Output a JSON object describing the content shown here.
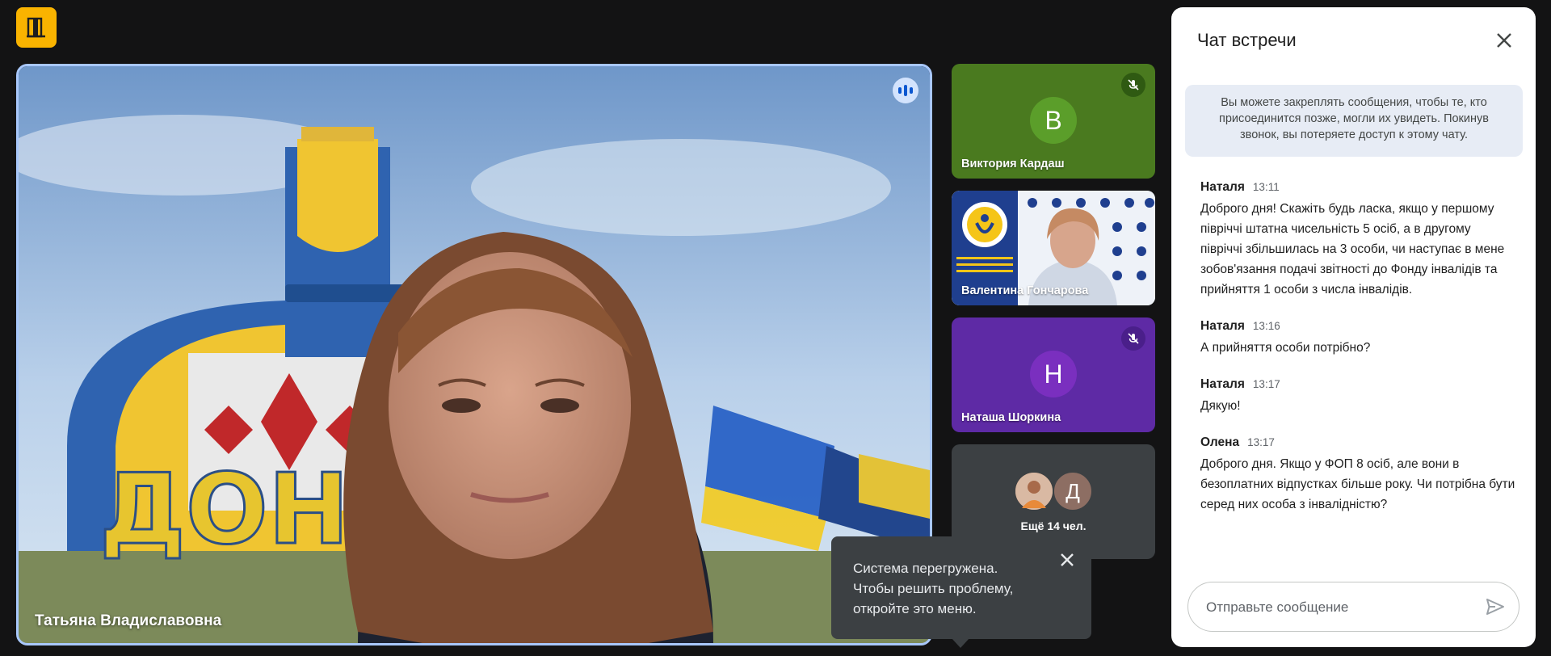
{
  "app": {
    "logo_icon": "exit-door-icon",
    "accent": "#f9b300"
  },
  "main_tile": {
    "participant_name": "Татьяна Владиславовна",
    "status_icon": "speaking-indicator-icon"
  },
  "side_tiles": [
    {
      "name": "Виктория Кардаш",
      "initial": "В",
      "avatar_color": "#5b9e2a",
      "bg": "#4a7a1f",
      "muted": true
    },
    {
      "name": "Валентина Гончарова",
      "video": true,
      "muted": false
    },
    {
      "name": "Наташа Шоркина",
      "initial": "Н",
      "avatar_color": "#7a2fbf",
      "bg": "#5e2aa5",
      "muted": true
    }
  ],
  "more_tile": {
    "label": "Ещё 14 чел.",
    "avatar_initial": "Д"
  },
  "tooltip": {
    "text": "Система перегружена. Чтобы решить проблему, откройте это меню."
  },
  "chat": {
    "title": "Чат встречи",
    "info": "Вы можете закреплять сообщения, чтобы те, кто присоединится позже, могли их увидеть. Покинув звонок, вы потеряете доступ к этому чату.",
    "messages": [
      {
        "author": "Наталя",
        "time": "13:11",
        "text": "Доброго дня! Скажіть будь ласка, якщо у першому півріччі штатна чисельність   5 осіб, а в другому півріччі збільшилась на 3 особи, чи наступає в мене зобов'язання подачі звітності до Фонду інвалідів та прийняття 1 особи з числа інвалідів."
      },
      {
        "author": "Наталя",
        "time": "13:16",
        "text": "А прийняття особи потрібно?"
      },
      {
        "author": "Наталя",
        "time": "13:17",
        "text": "Дякую!"
      },
      {
        "author": "Олена",
        "time": "13:17",
        "text": "Доброго дня. Якщо у ФОП 8 осіб, але вони в безоплатних відпустках більше року. Чи потрібна бути серед них особа з інвалідністю?"
      }
    ],
    "input_placeholder": "Отправьте сообщение"
  }
}
